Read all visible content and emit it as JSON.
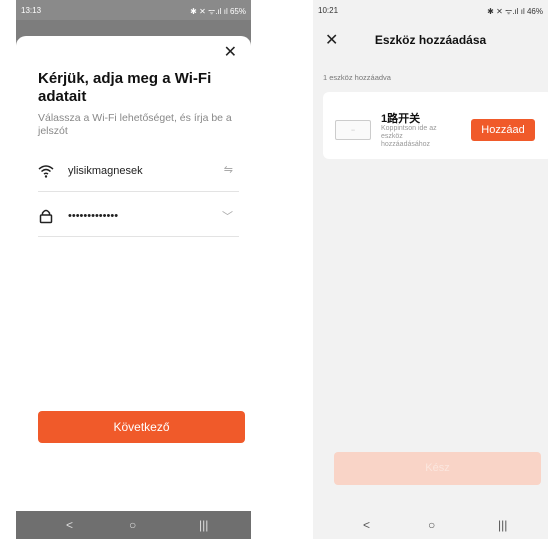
{
  "screen1": {
    "status": {
      "time": "13:13",
      "icons": "✱ ✕ ᯤ.ıl ıl 65%"
    },
    "title": "Kérjük, adja meg a Wi-Fi adatait",
    "subtitle": "Válassza a Wi-Fi lehetőséget, és írja be a jelszót",
    "ssid": "ylisikmagnesek",
    "password": "•••••••••••••",
    "next_label": "Következő",
    "nav": {
      "back": "<",
      "home": "○",
      "recent": "|||"
    }
  },
  "screen2": {
    "status": {
      "time": "10:21",
      "icons": "✱ ✕ ᯤ.ıl ıl 46%"
    },
    "title": "Eszköz hozzáadása",
    "count_text": "1 eszköz hozzáadva",
    "device": {
      "name": "1路开关",
      "hint": "Koppintson ide az eszköz hozzáadásához",
      "add_label": "Hozzáad"
    },
    "bottom_label": "Kész",
    "nav": {
      "back": "<",
      "home": "○",
      "recent": "|||"
    }
  }
}
